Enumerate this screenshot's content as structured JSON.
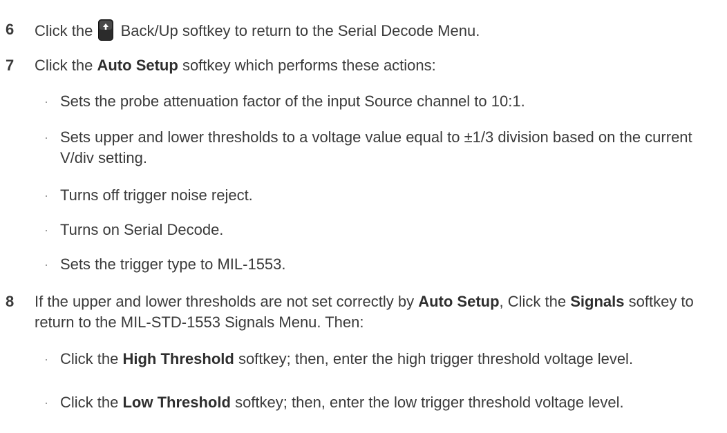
{
  "steps": [
    {
      "number": "6",
      "pre": "Click the",
      "post": "Back/Up softkey to return to the Serial Decode Menu."
    },
    {
      "number": "7",
      "pre": "Click the",
      "bold": "Auto Setup",
      "post": "softkey which performs these actions:"
    },
    {
      "number": "8",
      "pre": "If the upper and lower thresholds are not set correctly by",
      "bold1": "Auto Setup",
      "mid": ", Click the",
      "bold2": "Signals",
      "post": "softkey to return to the MIL-STD-1553 Signals Menu. Then:"
    }
  ],
  "step7_bullets": [
    "Sets the probe attenuation factor of the input Source channel to 10:1.",
    "Sets upper and lower thresholds to a voltage value equal to ±1/3 division based on the current V/div setting.",
    "Turns off trigger noise reject.",
    "Turns on Serial Decode.",
    "Sets the trigger type to MIL-1553."
  ],
  "step8_bullets": [
    {
      "pre": "Click the",
      "bold": "High Threshold",
      "post": "softkey; then, enter the high trigger threshold voltage level."
    },
    {
      "pre": "Click the",
      "bold": "Low Threshold",
      "post": "softkey; then, enter the low trigger threshold voltage level."
    }
  ],
  "bullet_symbol": "·",
  "softkey_icon": "back-up-arrow-icon"
}
